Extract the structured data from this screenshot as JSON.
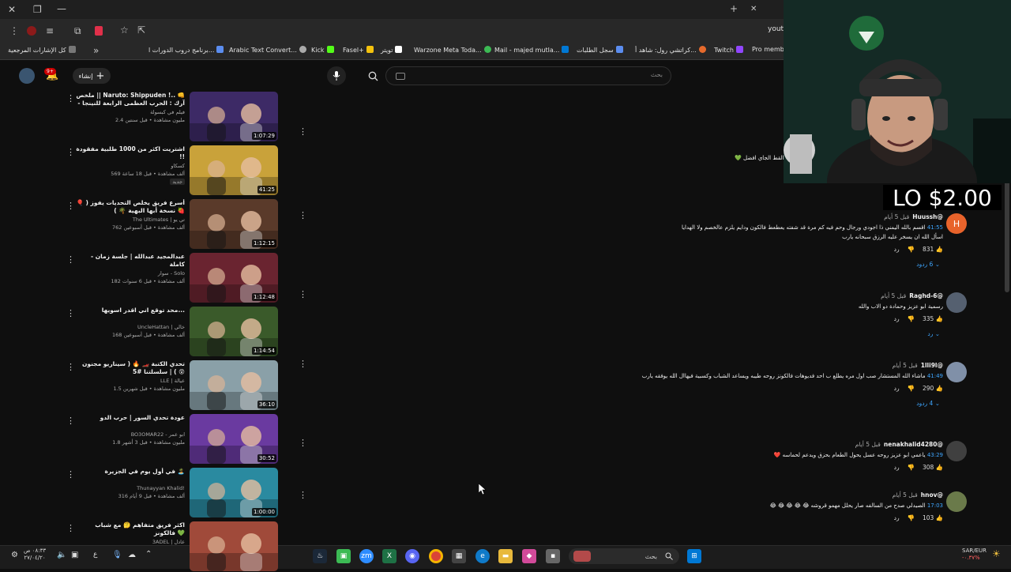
{
  "browser": {
    "tab_title": "youtube",
    "bookmarks": [
      {
        "label": "كل الإشارات المرجعية",
        "color": "#888"
      },
      {
        "label": "برنامج دروب الدورات ا...",
        "color": "#5b8def"
      },
      {
        "label": "Arabic Text Convert...",
        "color": "#aaa"
      },
      {
        "label": "Kick",
        "color": "#53fc18"
      },
      {
        "label": "Fasel+",
        "color": "#f4c20d"
      },
      {
        "label": "تويتر",
        "color": "#ffffff"
      },
      {
        "label": "Warzone Meta Toda...",
        "color": "#3cba54"
      },
      {
        "label": "Mail - majed mutla...",
        "color": "#0078d4"
      },
      {
        "label": "سجل الطلبات",
        "color": "#5b8def"
      },
      {
        "label": "كراتشي رول: شاهد أ...",
        "color": "#e66a2c"
      },
      {
        "label": "Twitch",
        "color": "#9146ff"
      },
      {
        "label": "Pro memb",
        "color": "#ccc"
      }
    ]
  },
  "youtube": {
    "create_label": "إنشاء",
    "notification_count": "9+",
    "search_placeholder": "بحث"
  },
  "videos": [
    {
      "title": "ملخص || Naruto: Shippuden !.. 👊 آرك : الحرب العظمى الرابعة للنينجا - [ف...",
      "channel": "فيلم في كبسولة",
      "meta": "2.4 مليون مشاهدة • قبل سنتين",
      "duration": "1:07:29",
      "thumb_color": "#3d2a66"
    },
    {
      "title": "اشتريت اكثر من 1000 طلبية مفقودة !!",
      "channel": "كسكاو",
      "meta": "569 ألف مشاهدة • قبل 18 ساعة",
      "badge": "جديد",
      "duration": "41:25",
      "thumb_color": "#c9a23a"
    },
    {
      "title": "أسرع فريق يخلص التحديات يفوز ( 🎈 🍓 نسخة أبها البهية 🌴 )",
      "channel": "The Ultimates | تي يو",
      "meta": "762 ألف مشاهدة • قبل أسبوعين",
      "duration": "1:12:15",
      "thumb_color": "#5a3a2a"
    },
    {
      "title": "عبدالمجيد عبدالله | جلسة زمان - كاملة",
      "channel": "سوار - Solo",
      "meta": "182 ألف مشاهدة • قبل 6 سنوات",
      "duration": "1:12:48",
      "thumb_color": "#6a2430"
    },
    {
      "title": "محد توقع اني اقدر اسويها...",
      "channel": "UncleHattan | خالي",
      "meta": "168 ألف مشاهدة • قبل أسبوعين",
      "duration": "1:14:54",
      "thumb_color": "#3a5a2a"
    },
    {
      "title": "تحدي الكتبة 🏎️ 🔥 ( سيناريو مجنون 😵 ) | سلسلتنا #5",
      "channel": "LLE | عيالة",
      "meta": "1.5 مليون مشاهدة • قبل شهرين",
      "duration": "36:10",
      "thumb_color": "#8aa0a8"
    },
    {
      "title": "عودة تحدي السور | حرب الدو",
      "channel": "BO3OMAR22 - ابو عمر",
      "meta": "1.8 مليون مشاهدة • قبل 3 أشهر",
      "duration": "30:52",
      "thumb_color": "#6a3aa0"
    },
    {
      "title": "في أول يوم في الجزيرة 🏝️",
      "channel": "Thunayyan Khalid!",
      "meta": "316 ألف مشاهدة • قبل 9 أيام",
      "duration": "1:00:00",
      "thumb_color": "#2a8aa0"
    },
    {
      "title": "اكثر فريق متفاهم 🤔 مع شباب فالكونز 💚",
      "channel": "3ADEL | عادل",
      "meta": "",
      "duration": "",
      "thumb_color": "#a04a3a"
    }
  ],
  "comments_top": {
    "partial_text": "...القط الجاي افضل 💚"
  },
  "comments": [
    {
      "author": "@Huussh",
      "when": "قبل 5 أيام",
      "timestamp": "41:55",
      "text": "اقسم بالله اليمني ذا اجودي ورجال وحم فيه كم مرة قد شفته يعطعط فالكون ودايم يلزم عالخصم ولا الهدايا",
      "text2": "اسأل الله ان يسخر عليه الرزق سبحانه يارب",
      "likes": "831",
      "reply": "رد",
      "replies": "6 ردود",
      "avatar_color": "#e8632b",
      "avatar_letter": "H"
    },
    {
      "author": "@Raghd-6",
      "when": "قبل 5 أيام",
      "timestamp": "",
      "text": "رسمية ابو عزيز وحمادة دو الاب والله",
      "text2": "",
      "likes": "335",
      "reply": "رد",
      "replies": "رد",
      "avatar_color": "#556070",
      "avatar_letter": ""
    },
    {
      "author": "@1lli9l",
      "when": "قبل 5 أيام",
      "timestamp": "41:49",
      "text": "ماشاء الله المستشار صب اول مره يطلع ب احد فديوهات فالكونز روحه طيبه ويساعد الشباب وكسبية فيهاال الله يوفقه يارب",
      "text2": "",
      "likes": "290",
      "reply": "رد",
      "replies": "4 ردود",
      "avatar_color": "#8090a8",
      "avatar_letter": ""
    },
    {
      "author": "@nenakhalid4280",
      "when": "قبل 5 أيام",
      "timestamp": "43:29",
      "text": "ياعمي ابو عزيز روحه عسل يحول الطعام بحزق ويدعم لحماسه ❤️",
      "text2": "",
      "likes": "308",
      "reply": "رد",
      "replies": "",
      "avatar_color": "#404040",
      "avatar_letter": ""
    },
    {
      "author": "@hnov",
      "when": "قبل 5 أيام",
      "timestamp": "17:03",
      "text": "الصيدلي صدح من السالفه صار يحلل مهمو قروشه 😂 😂 😂 😂 😂",
      "text2": "",
      "likes": "103",
      "reply": "رد",
      "replies": "",
      "avatar_color": "#6a7a4a",
      "avatar_letter": ""
    }
  ],
  "overlay": {
    "donation": "LO  $2.00"
  },
  "taskbar": {
    "time": "٠٨:٣٣ ص",
    "date": "٢٧/٠٤/٢٠",
    "search": "بحث",
    "currency": "SAR/EUR",
    "currency_change": "-٠.٣٧%"
  }
}
